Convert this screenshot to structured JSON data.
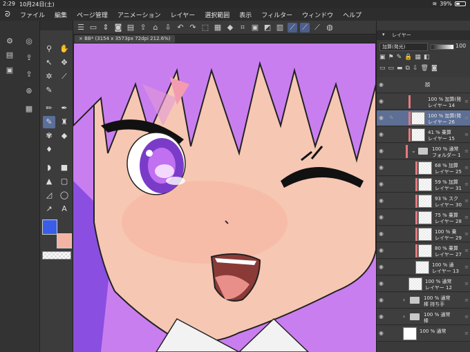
{
  "status": {
    "time": "2:29",
    "date": "10月24日(土)",
    "battery": "39%"
  },
  "menu": [
    "ファイル",
    "編集",
    "ページ管理",
    "アニメーション",
    "レイヤー",
    "選択範囲",
    "表示",
    "フィルター",
    "ウィンドウ",
    "ヘルプ"
  ],
  "tab": {
    "label": "BB* (3154 x 3573px 72dpi 212.6%)"
  },
  "colors": {
    "main": "#3a5de8",
    "sub": "#f3b4a6",
    "canvas_bg": "#c97ef0",
    "accent": "#5d6f95"
  },
  "panel": {
    "tab_label": "レイヤー",
    "blend_mode": "加算(発光)",
    "opacity": "100"
  },
  "layers": [
    {
      "type": "layer",
      "line1": "",
      "line2": "顔"
    },
    {
      "type": "layer",
      "line1": "100 % 加算(発",
      "line2": "レイヤー 14"
    },
    {
      "type": "layer",
      "line1": "100 % 加算(発",
      "line2": "レイヤー 26",
      "selected": true
    },
    {
      "type": "layer",
      "line1": "41 % 乗算",
      "line2": "レイヤー 15"
    },
    {
      "type": "folder",
      "line1": "100 % 通常",
      "line2": "フォルダー 1"
    },
    {
      "type": "layer",
      "line1": "68 % 加算",
      "line2": "レイヤー 25"
    },
    {
      "type": "layer",
      "line1": "59 % 加算",
      "line2": "レイヤー 31"
    },
    {
      "type": "layer",
      "line1": "93 % スク",
      "line2": "レイヤー 30"
    },
    {
      "type": "layer",
      "line1": "75 % 乗算",
      "line2": "レイヤー 28"
    },
    {
      "type": "layer",
      "line1": "100 % 乗",
      "line2": "レイヤー 29"
    },
    {
      "type": "layer",
      "line1": "80 % 乗算",
      "line2": "レイヤー 27"
    },
    {
      "type": "layer",
      "line1": "100 % 通",
      "line2": "レイヤー 13"
    },
    {
      "type": "layer",
      "line1": "100 % 通常",
      "line2": "レイヤー 12"
    },
    {
      "type": "folder",
      "line1": "100 % 通常",
      "line2": "棒 持ち手"
    },
    {
      "type": "folder",
      "line1": "100 % 通常",
      "line2": "棒"
    },
    {
      "type": "layer",
      "line1": "100 % 通常",
      "line2": ""
    }
  ]
}
